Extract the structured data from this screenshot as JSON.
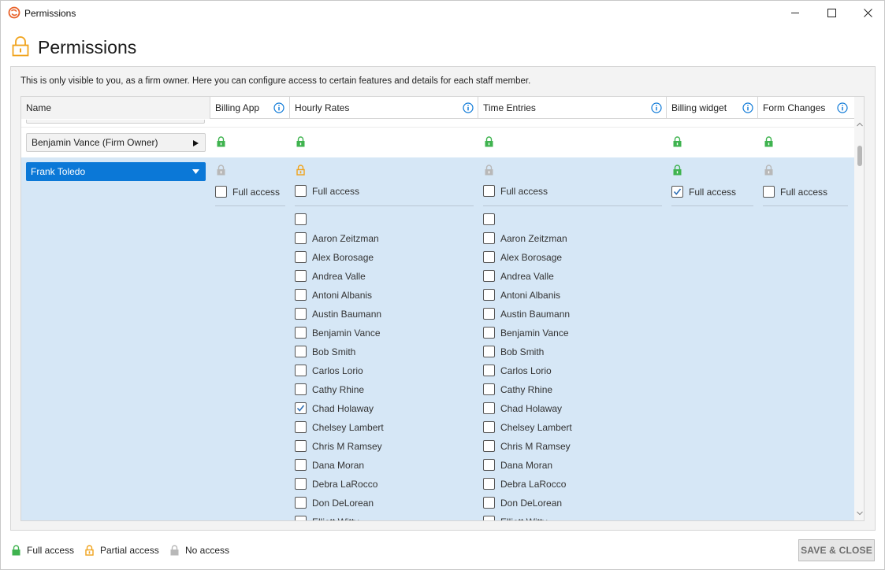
{
  "window": {
    "title": "Permissions"
  },
  "page": {
    "title": "Permissions",
    "info": "This is only visible to you, as a firm owner. Here you can configure access to certain features and details for each staff member."
  },
  "columns": [
    {
      "label": "Name",
      "has_info": false
    },
    {
      "label": "Billing App",
      "has_info": true
    },
    {
      "label": "Hourly Rates",
      "has_info": true
    },
    {
      "label": "Time Entries",
      "has_info": true
    },
    {
      "label": "Billing widget",
      "has_info": true
    },
    {
      "label": "Form Changes",
      "has_info": true
    }
  ],
  "colors": {
    "full_access": "#3fb34f",
    "partial_access": "#f0a31c",
    "no_access": "#b8b8b8",
    "selection": "#0b78d7",
    "row_highlight": "#d6e7f6"
  },
  "owner_row": {
    "name": "Benjamin Vance (Firm Owner)",
    "locks": [
      "full",
      "full",
      "full",
      "full",
      "full"
    ]
  },
  "selected_row": {
    "name": "Frank Toledo",
    "locks": [
      "none",
      "partial",
      "none",
      "full",
      "none"
    ],
    "full_access_label": "Full access",
    "full_access": {
      "billing_app": false,
      "hourly_rates": false,
      "time_entries": false,
      "billing_widget": true,
      "form_changes": false
    }
  },
  "staff": [
    "",
    "Aaron Zeitzman",
    "Alex Borosage",
    "Andrea Valle",
    "Antoni Albanis",
    "Austin Baumann",
    "Benjamin Vance",
    "Bob Smith",
    "Carlos Lorio",
    "Cathy Rhine",
    "Chad Holaway",
    "Chelsey Lambert",
    "Chris M Ramsey",
    "Dana Moran",
    "Debra LaRocco",
    "Don DeLorean",
    "Elliott Witty"
  ],
  "hourly_rates_checked": [
    "Chad Holaway"
  ],
  "time_entries_checked": [],
  "legend": {
    "full": "Full access",
    "partial": "Partial access",
    "none": "No access"
  },
  "save_label": "SAVE & CLOSE"
}
